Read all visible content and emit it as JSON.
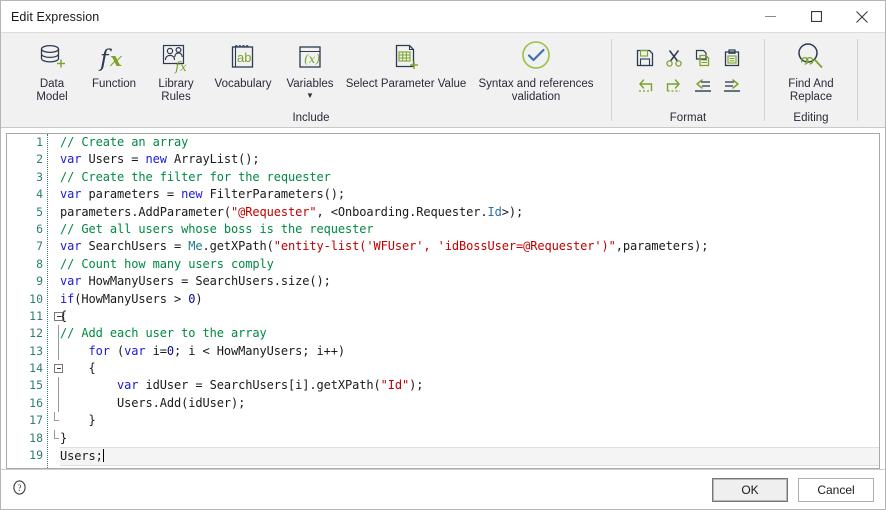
{
  "window": {
    "title": "Edit Expression",
    "controls": [
      {
        "name": "minimize-button",
        "glyph": "minimize"
      },
      {
        "name": "maximize-button",
        "glyph": "maximize"
      },
      {
        "name": "close-button",
        "glyph": "close"
      }
    ]
  },
  "ribbon": {
    "groups": [
      {
        "label": "Include",
        "buttons": [
          {
            "label": "Data\nModel",
            "icon": "database-plus-icon",
            "caret": false
          },
          {
            "label": "Function",
            "icon": "fx-icon",
            "caret": false
          },
          {
            "label": "Library\nRules",
            "icon": "library-rules-icon",
            "caret": false
          },
          {
            "label": "Vocabulary",
            "icon": "vocabulary-icon",
            "caret": false
          },
          {
            "label": "Variables",
            "icon": "variables-icon",
            "caret": true
          },
          {
            "label": "Select Parameter\nValue",
            "icon": "select-parameter-value-icon",
            "caret": false
          },
          {
            "label": "Syntax and references\nvalidation",
            "icon": "syntax-validation-icon",
            "caret": false
          }
        ]
      },
      {
        "label": "Format",
        "small_buttons": [
          {
            "label": "Save",
            "icon": "save-icon"
          },
          {
            "label": "Cut",
            "icon": "cut-icon"
          },
          {
            "label": "Copy",
            "icon": "copy-icon"
          },
          {
            "label": "Paste",
            "icon": "paste-icon"
          },
          {
            "label": "Undo",
            "icon": "undo-icon"
          },
          {
            "label": "Redo",
            "icon": "redo-icon"
          },
          {
            "label": "Outdent",
            "icon": "outdent-icon"
          },
          {
            "label": "Indent",
            "icon": "indent-icon"
          }
        ]
      },
      {
        "label": "Editing",
        "buttons": [
          {
            "label": "Find And\nReplace",
            "icon": "find-replace-icon",
            "caret": false
          }
        ]
      }
    ]
  },
  "editor": {
    "current_line": 19,
    "fold_markers": [
      11,
      14
    ],
    "lines": [
      {
        "n": 1,
        "text": "// Create an array"
      },
      {
        "n": 2,
        "text": "var Users = new ArrayList();"
      },
      {
        "n": 3,
        "text": "// Create the filter for the requester"
      },
      {
        "n": 4,
        "text": "var parameters = new FilterParameters();"
      },
      {
        "n": 5,
        "text": "parameters.AddParameter(\"@Requester\", <Onboarding.Requester.Id>);"
      },
      {
        "n": 6,
        "text": "// Get all users whose boss is the requester"
      },
      {
        "n": 7,
        "text": "var SearchUsers = Me.getXPath(\"entity-list('WFUser', 'idBossUser=@Requester')\",parameters);"
      },
      {
        "n": 8,
        "text": "// Count how many users comply"
      },
      {
        "n": 9,
        "text": "var HowManyUsers = SearchUsers.size();"
      },
      {
        "n": 10,
        "text": "if(HowManyUsers > 0)"
      },
      {
        "n": 11,
        "text": "{"
      },
      {
        "n": 12,
        "text": "// Add each user to the array"
      },
      {
        "n": 13,
        "text": "    for (var i=0; i < HowManyUsers; i++)"
      },
      {
        "n": 14,
        "text": "    {"
      },
      {
        "n": 15,
        "text": "        var idUser = SearchUsers[i].getXPath(\"Id\");"
      },
      {
        "n": 16,
        "text": "        Users.Add(idUser);"
      },
      {
        "n": 17,
        "text": "    }"
      },
      {
        "n": 18,
        "text": "}"
      },
      {
        "n": 19,
        "text": "Users;"
      }
    ]
  },
  "footer": {
    "help_icon": "help-icon",
    "ok_label": "OK",
    "cancel_label": "Cancel"
  },
  "colors": {
    "comment": "#008a43",
    "keyword": "#1a1ad6",
    "string": "#c00000",
    "line_number": "#2f7d72",
    "icon_green": "#7aa32a",
    "icon_navy": "#2d3a52",
    "ribbon_bg": "#f1f1f1"
  }
}
